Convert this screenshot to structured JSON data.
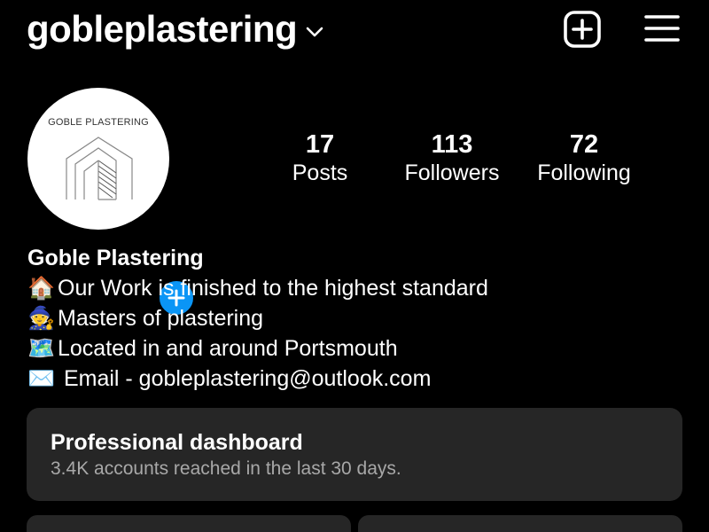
{
  "header": {
    "username": "gobleplastering",
    "icons": [
      "chevron-down-icon",
      "new-post-icon",
      "menu-icon"
    ]
  },
  "avatar": {
    "logo_text": "GOBLE PLASTERING"
  },
  "stats": {
    "posts": {
      "count": "17",
      "label": "Posts"
    },
    "followers": {
      "count": "113",
      "label": "Followers"
    },
    "following": {
      "count": "72",
      "label": "Following"
    }
  },
  "bio": {
    "name": "Goble Plastering",
    "lines": [
      {
        "emoji": "🏠",
        "text": "Our Work is finished to the highest standard"
      },
      {
        "emoji": "🧙",
        "text": "Masters of plastering"
      },
      {
        "emoji": "🗺️",
        "text": "Located in and around Portsmouth"
      },
      {
        "emoji": "✉️",
        "text": " Email - gobleplastering@outlook.com"
      }
    ]
  },
  "dashboard": {
    "title": "Professional dashboard",
    "subtitle": "3.4K accounts reached in the last 30 days."
  },
  "colors": {
    "background": "#000000",
    "card": "#262626",
    "accent_blue": "#0a95f6",
    "secondary_text": "#a8a8a8"
  }
}
